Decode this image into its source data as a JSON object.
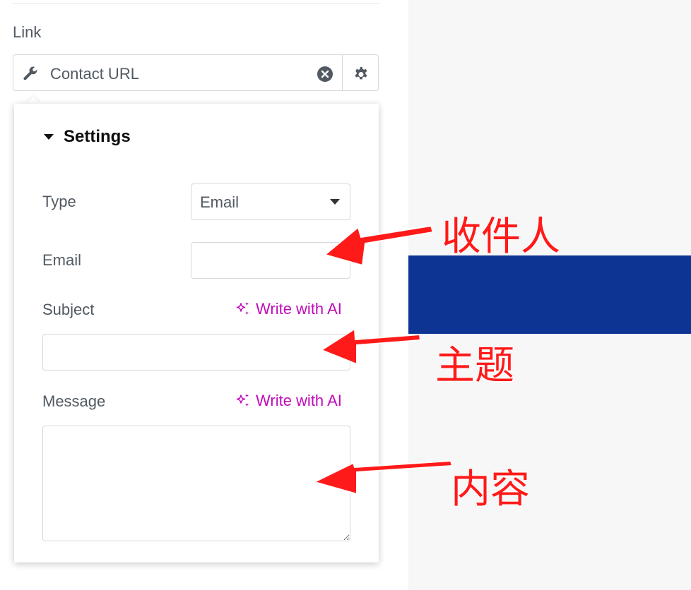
{
  "link": {
    "label": "Link",
    "value": "Contact URL"
  },
  "settings": {
    "title": "Settings",
    "type_label": "Type",
    "type_value": "Email",
    "email_label": "Email",
    "email_value": "",
    "subject_label": "Subject",
    "subject_value": "",
    "message_label": "Message",
    "message_value": "",
    "ai_label": "Write with AI"
  },
  "annotations": {
    "recipient": "收件人",
    "subject": "主题",
    "content": "内容"
  },
  "colors": {
    "accent_ai": "#c00bb9",
    "annotation": "#ff1a1a",
    "canvas_band": "#0e3493"
  },
  "icons": [
    "wrench-icon",
    "clear-icon",
    "gear-icon",
    "caret-down-icon",
    "sparkle-icon",
    "arrow-icon"
  ]
}
